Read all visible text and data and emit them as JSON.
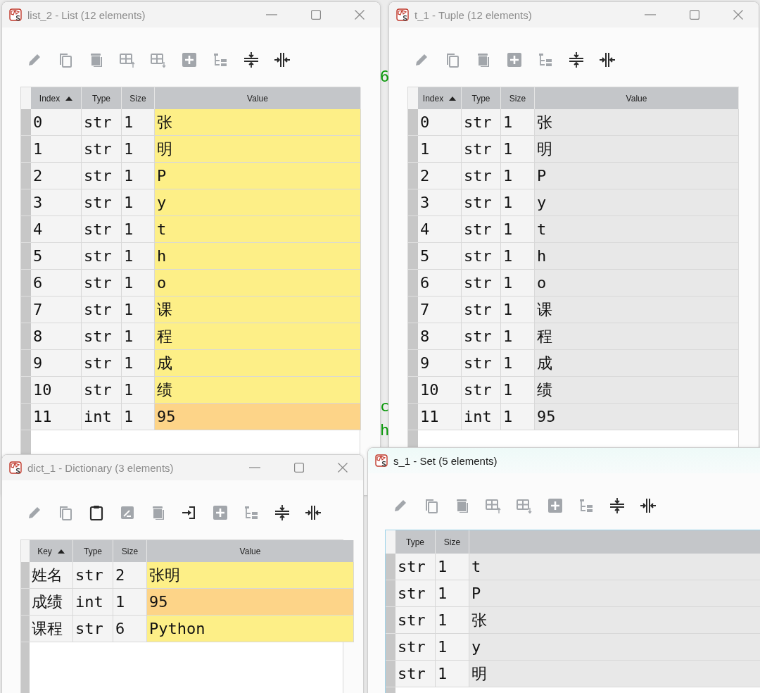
{
  "background_fragments": [
    "6",
    "c",
    "h"
  ],
  "windows": [
    {
      "title": "list_2 - List (12 elements)",
      "active": false,
      "window_controls": [
        {
          "kind": "minimize"
        },
        {
          "kind": "maximize"
        },
        {
          "kind": "close"
        }
      ],
      "toolbar": [
        {
          "kind": "edit",
          "disabled": true
        },
        {
          "kind": "copy",
          "disabled": true
        },
        {
          "kind": "delete",
          "disabled": true
        },
        {
          "kind": "insert_above",
          "disabled": true
        },
        {
          "kind": "insert_below",
          "disabled": true
        },
        {
          "kind": "add",
          "disabled": true
        },
        {
          "kind": "tree",
          "disabled": true
        },
        {
          "kind": "collapse_rows",
          "disabled": false
        },
        {
          "kind": "collapse_cols",
          "disabled": false
        }
      ],
      "table": {
        "columns": [
          {
            "label": "Index",
            "sorted": true
          },
          {
            "label": "Type",
            "sorted": false
          },
          {
            "label": "Size",
            "sorted": false
          },
          {
            "label": "Value",
            "sorted": false
          }
        ],
        "rows": [
          {
            "cells": [
              "0",
              "str",
              "1",
              "张"
            ],
            "color": "#fdef87"
          },
          {
            "cells": [
              "1",
              "str",
              "1",
              "明"
            ],
            "color": "#fdef87"
          },
          {
            "cells": [
              "2",
              "str",
              "1",
              "P"
            ],
            "color": "#fdef87"
          },
          {
            "cells": [
              "3",
              "str",
              "1",
              "y"
            ],
            "color": "#fdef87"
          },
          {
            "cells": [
              "4",
              "str",
              "1",
              "t"
            ],
            "color": "#fdef87"
          },
          {
            "cells": [
              "5",
              "str",
              "1",
              "h"
            ],
            "color": "#fdef87"
          },
          {
            "cells": [
              "6",
              "str",
              "1",
              "o"
            ],
            "color": "#fdef87"
          },
          {
            "cells": [
              "7",
              "str",
              "1",
              "课"
            ],
            "color": "#fdef87"
          },
          {
            "cells": [
              "8",
              "str",
              "1",
              "程"
            ],
            "color": "#fdef87"
          },
          {
            "cells": [
              "9",
              "str",
              "1",
              "成"
            ],
            "color": "#fdef87"
          },
          {
            "cells": [
              "10",
              "str",
              "1",
              "绩"
            ],
            "color": "#fdef87"
          },
          {
            "cells": [
              "11",
              "int",
              "1",
              "95"
            ],
            "color": "#fdd488"
          }
        ]
      }
    },
    {
      "title": "t_1 - Tuple (12 elements)",
      "active": false,
      "window_controls": [
        {
          "kind": "minimize"
        },
        {
          "kind": "maximize"
        },
        {
          "kind": "close"
        }
      ],
      "toolbar": [
        {
          "kind": "edit",
          "disabled": true
        },
        {
          "kind": "copy",
          "disabled": true
        },
        {
          "kind": "delete",
          "disabled": true
        },
        {
          "kind": "add",
          "disabled": true
        },
        {
          "kind": "tree",
          "disabled": true
        },
        {
          "kind": "collapse_rows",
          "disabled": false
        },
        {
          "kind": "collapse_cols",
          "disabled": false
        }
      ],
      "table": {
        "columns": [
          {
            "label": "Index",
            "sorted": true
          },
          {
            "label": "Type",
            "sorted": false
          },
          {
            "label": "Size",
            "sorted": false
          },
          {
            "label": "Value",
            "sorted": false
          }
        ],
        "rows": [
          {
            "cells": [
              "0",
              "str",
              "1",
              "张"
            ]
          },
          {
            "cells": [
              "1",
              "str",
              "1",
              "明"
            ]
          },
          {
            "cells": [
              "2",
              "str",
              "1",
              "P"
            ]
          },
          {
            "cells": [
              "3",
              "str",
              "1",
              "y"
            ]
          },
          {
            "cells": [
              "4",
              "str",
              "1",
              "t"
            ]
          },
          {
            "cells": [
              "5",
              "str",
              "1",
              "h"
            ]
          },
          {
            "cells": [
              "6",
              "str",
              "1",
              "o"
            ]
          },
          {
            "cells": [
              "7",
              "str",
              "1",
              "课"
            ]
          },
          {
            "cells": [
              "8",
              "str",
              "1",
              "程"
            ]
          },
          {
            "cells": [
              "9",
              "str",
              "1",
              "成"
            ]
          },
          {
            "cells": [
              "10",
              "str",
              "1",
              "绩"
            ]
          },
          {
            "cells": [
              "11",
              "int",
              "1",
              "95"
            ]
          }
        ]
      }
    },
    {
      "title": "dict_1 - Dictionary (3 elements)",
      "active": false,
      "window_controls": [
        {
          "kind": "minimize"
        },
        {
          "kind": "maximize"
        },
        {
          "kind": "close"
        }
      ],
      "toolbar": [
        {
          "kind": "edit",
          "disabled": true
        },
        {
          "kind": "copy",
          "disabled": true
        },
        {
          "kind": "paste",
          "disabled": false
        },
        {
          "kind": "rename",
          "disabled": true
        },
        {
          "kind": "delete",
          "disabled": true
        },
        {
          "kind": "import",
          "disabled": false
        },
        {
          "kind": "add",
          "disabled": true
        },
        {
          "kind": "tree",
          "disabled": true
        },
        {
          "kind": "collapse_rows",
          "disabled": false
        },
        {
          "kind": "collapse_cols",
          "disabled": false
        }
      ],
      "table": {
        "columns": [
          {
            "label": "Key",
            "sorted": true
          },
          {
            "label": "Type",
            "sorted": false
          },
          {
            "label": "Size",
            "sorted": false
          },
          {
            "label": "Value",
            "sorted": false
          }
        ],
        "rows": [
          {
            "cells": [
              "姓名",
              "str",
              "2",
              "张明"
            ],
            "color": "#fdef87"
          },
          {
            "cells": [
              "成绩",
              "int",
              "1",
              "95"
            ],
            "color": "#fdd488"
          },
          {
            "cells": [
              "课程",
              "str",
              "6",
              "Python"
            ],
            "color": "#fdef87"
          }
        ]
      }
    },
    {
      "title": "s_1 - Set (5 elements)",
      "active": true,
      "toolbar": [
        {
          "kind": "edit",
          "disabled": true
        },
        {
          "kind": "copy",
          "disabled": true
        },
        {
          "kind": "delete",
          "disabled": true
        },
        {
          "kind": "insert_above",
          "disabled": true
        },
        {
          "kind": "insert_below",
          "disabled": true
        },
        {
          "kind": "add",
          "disabled": true
        },
        {
          "kind": "tree",
          "disabled": true
        },
        {
          "kind": "collapse_rows",
          "disabled": false
        },
        {
          "kind": "collapse_cols",
          "disabled": false
        }
      ],
      "table": {
        "columns": [
          {
            "label": "Type",
            "sorted": false
          },
          {
            "label": "Size",
            "sorted": false
          },
          {}
        ],
        "rows": [
          {
            "cells": [
              "str",
              "1",
              "t"
            ]
          },
          {
            "cells": [
              "str",
              "1",
              "P"
            ]
          },
          {
            "cells": [
              "str",
              "1",
              "张"
            ]
          },
          {
            "cells": [
              "str",
              "1",
              "y"
            ]
          },
          {
            "cells": [
              "str",
              "1",
              "明"
            ]
          }
        ]
      }
    }
  ]
}
